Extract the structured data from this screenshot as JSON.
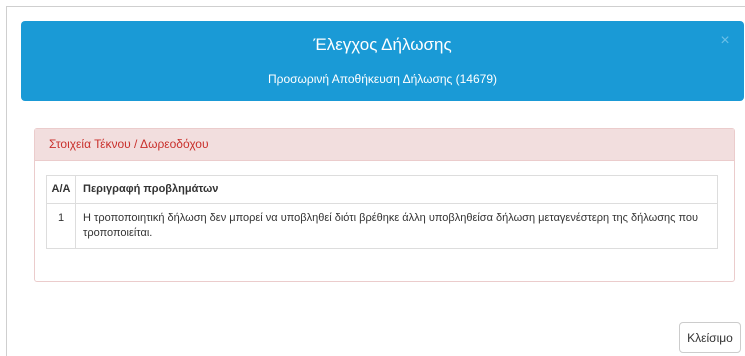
{
  "modal": {
    "title": "Έλεγχος Δήλωσης",
    "subtitle": "Προσωρινή Αποθήκευση Δήλωσης (14679)",
    "close_icon": "×"
  },
  "panel": {
    "heading": "Στοιχεία Τέκνου / Δωρεοδόχου",
    "table": {
      "columns": [
        "Α/Α",
        "Περιγραφή προβλημάτων"
      ],
      "rows": [
        {
          "aa": "1",
          "description": "Η τροποποιητική δήλωση δεν μπορεί να υποβληθεί διότι βρέθηκε άλλη υποβληθείσα δήλωση μεταγενέστερη της δήλωσης που τροποποιείται."
        }
      ]
    }
  },
  "footer": {
    "close_label": "Κλείσιμο"
  },
  "colors": {
    "header_bg": "#1a9ad6",
    "panel_heading_bg": "#f2dede",
    "panel_heading_text": "#c9302c"
  }
}
